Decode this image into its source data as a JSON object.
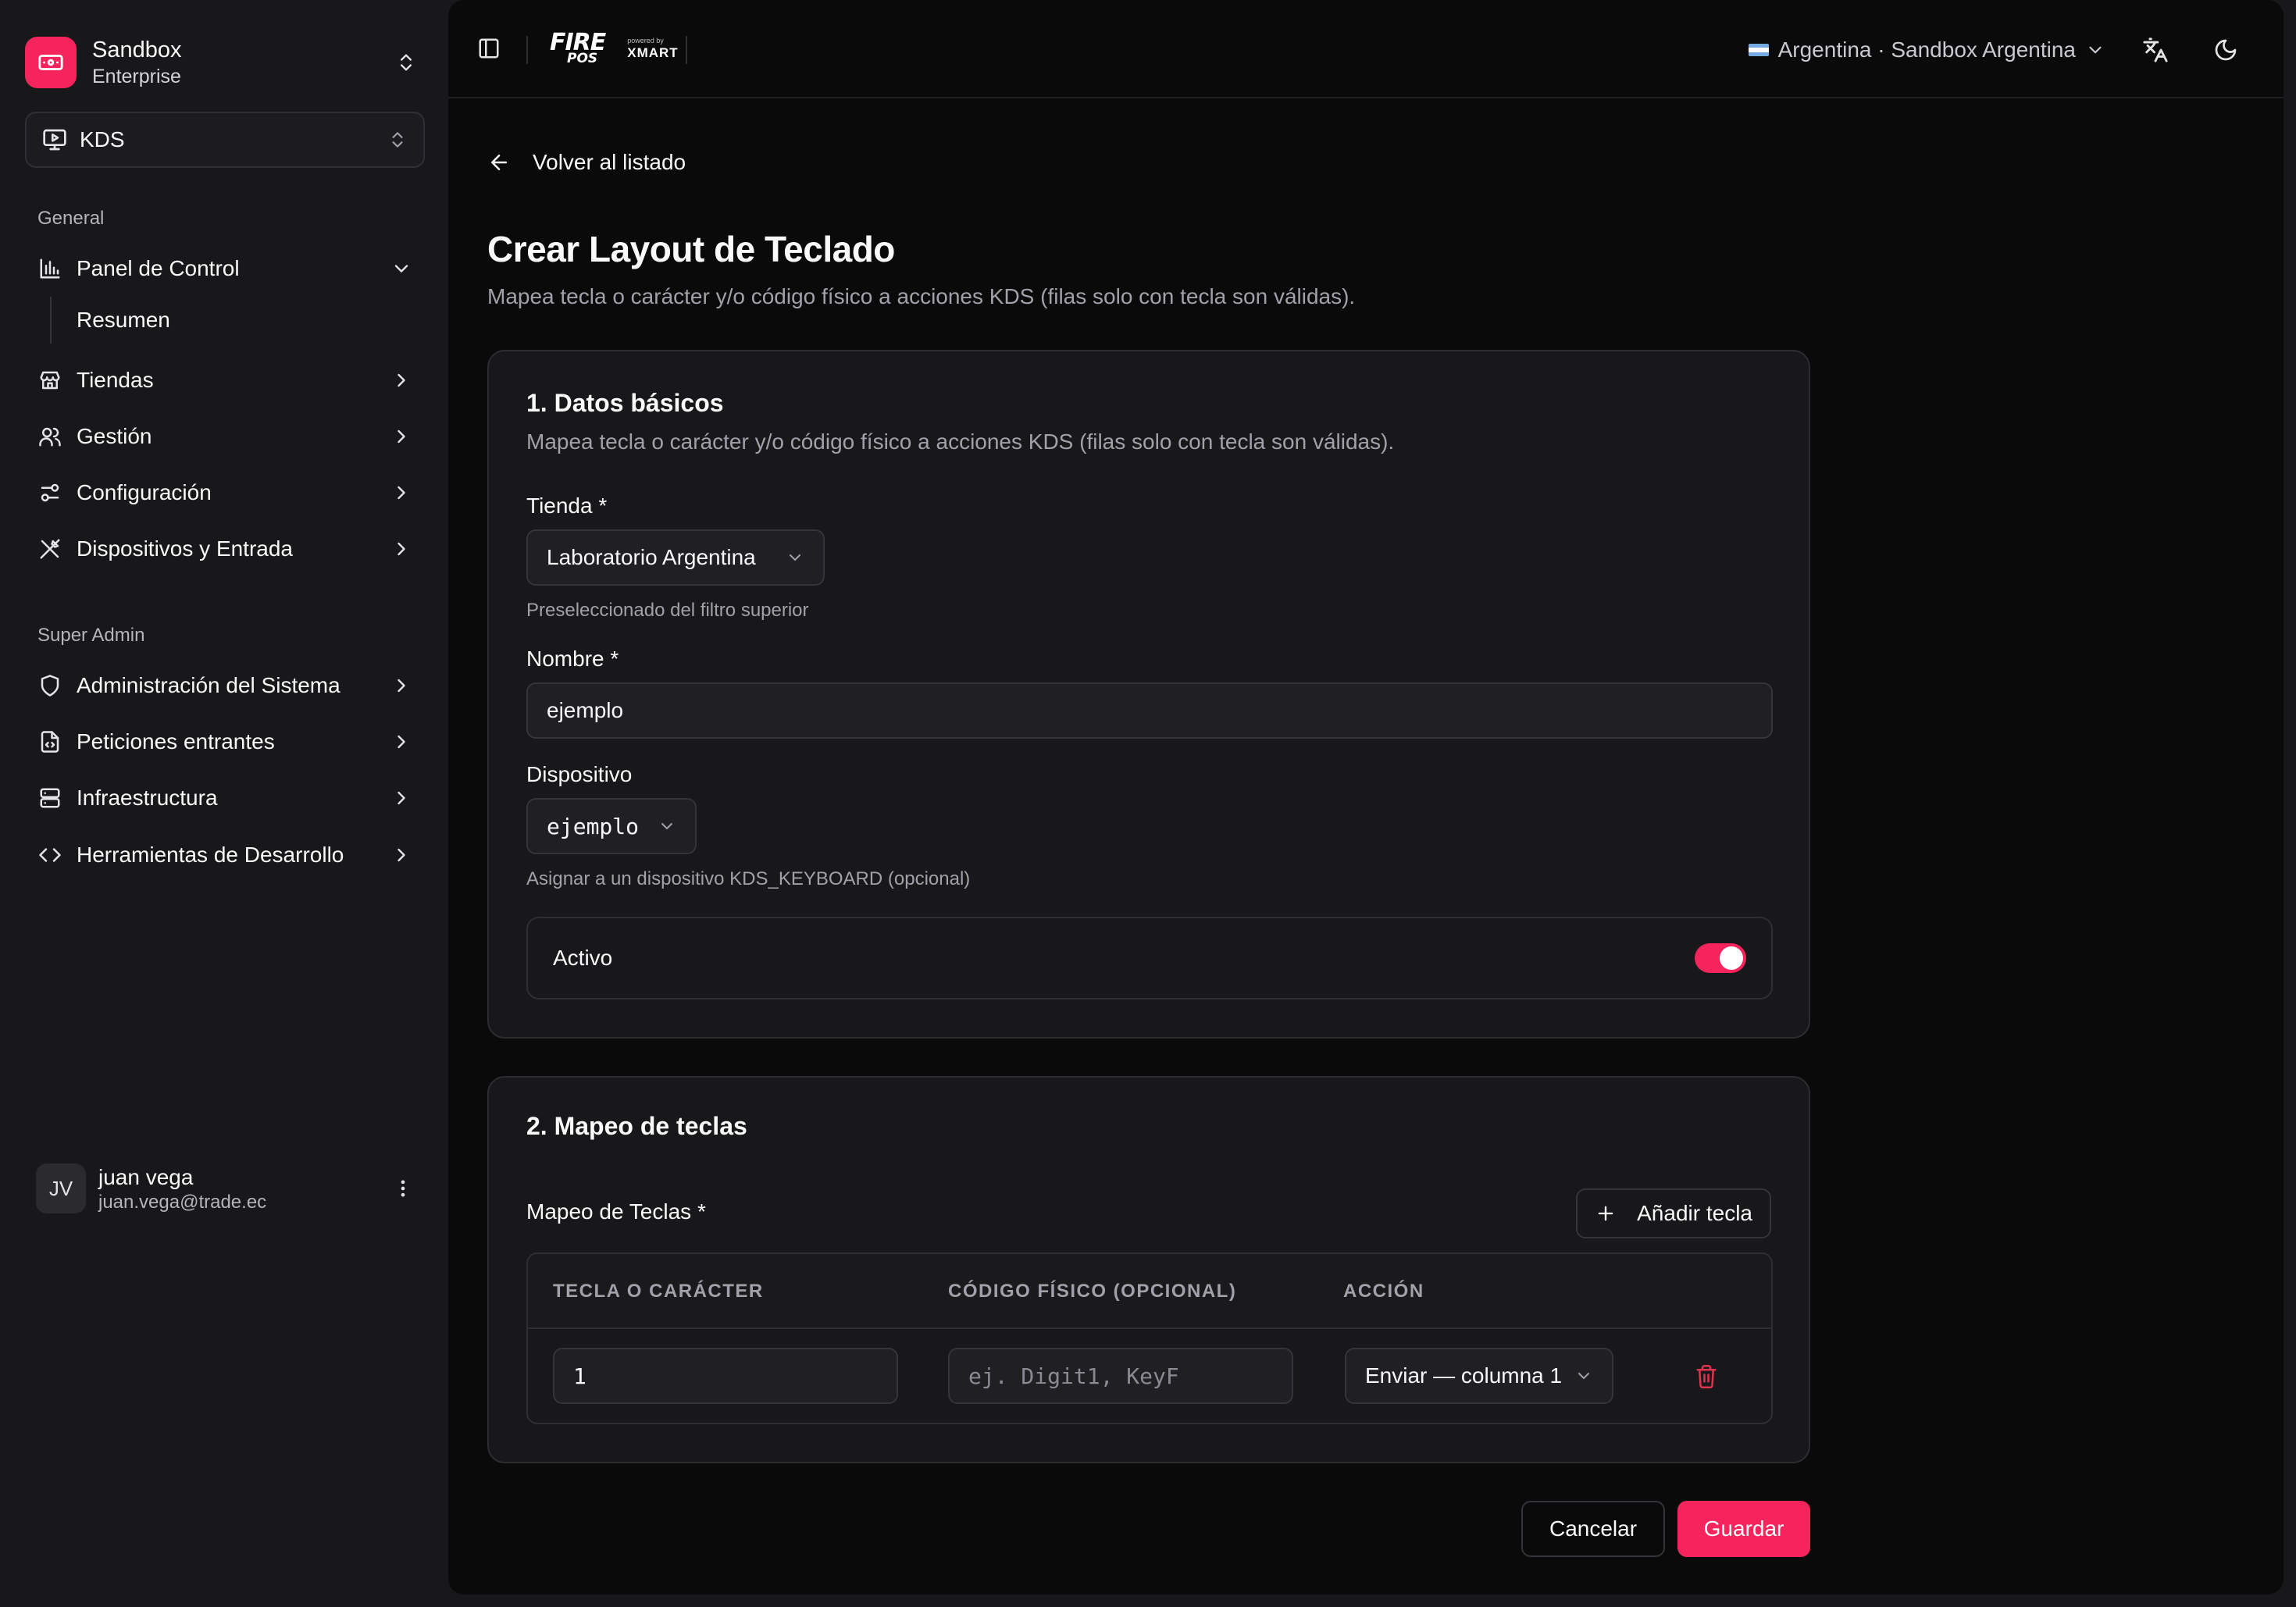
{
  "organization": {
    "name": "Sandbox",
    "plan": "Enterprise"
  },
  "app_selector": {
    "label": "KDS"
  },
  "sidebar": {
    "general_label": "General",
    "general_items": [
      {
        "label": "Panel de Control",
        "icon": "bar-chart-icon",
        "expanded": true
      },
      {
        "label": "Tiendas",
        "icon": "store-icon"
      },
      {
        "label": "Gestión",
        "icon": "users-icon"
      },
      {
        "label": "Configuración",
        "icon": "sliders-icon"
      },
      {
        "label": "Dispositivos y Entrada",
        "icon": "tools-icon"
      }
    ],
    "subitem": "Resumen",
    "super_admin_label": "Super Admin",
    "admin_items": [
      {
        "label": "Administración del Sistema",
        "icon": "shield-icon"
      },
      {
        "label": "Peticiones entrantes",
        "icon": "file-code-icon"
      },
      {
        "label": "Infraestructura",
        "icon": "server-icon"
      },
      {
        "label": "Herramientas de Desarrollo",
        "icon": "code-icon"
      }
    ]
  },
  "user": {
    "initials": "JV",
    "name": "juan vega",
    "email": "juan.vega@trade.ec"
  },
  "topbar": {
    "brand_fire": "FIRE",
    "brand_pos": "POS",
    "brand_powered": "powered by",
    "brand_xmart": "XMART",
    "country": "Argentina · Sandbox Argentina",
    "translate_icon": "translate-icon",
    "theme_icon": "moon-icon"
  },
  "page": {
    "back_label": "Volver al listado",
    "title": "Crear Layout de Teclado",
    "subtitle": "Mapea tecla o carácter y/o código físico a acciones KDS (filas solo con tecla son válidas)."
  },
  "basic": {
    "title": "1. Datos básicos",
    "subtitle": "Mapea tecla o carácter y/o código físico a acciones KDS (filas solo con tecla son válidas).",
    "store_label": "Tienda *",
    "store_value": "Laboratorio Argentina",
    "store_hint": "Preseleccionado del filtro superior",
    "name_label": "Nombre *",
    "name_value": "ejemplo",
    "device_label": "Dispositivo",
    "device_value": "ejemplo",
    "device_hint": "Asignar a un dispositivo KDS_KEYBOARD (opcional)",
    "active_label": "Activo",
    "active": true
  },
  "mapping": {
    "title": "2. Mapeo de teclas",
    "label": "Mapeo de Teclas *",
    "add_label": "Añadir tecla",
    "columns": [
      "TECLA O CARÁCTER",
      "CÓDIGO FÍSICO (OPCIONAL)",
      "ACCIÓN"
    ],
    "rows": [
      {
        "key": "1",
        "code_placeholder": "ej. Digit1, KeyF",
        "action": "Enviar — columna 1"
      }
    ]
  },
  "actions": {
    "cancel": "Cancelar",
    "save": "Guardar"
  },
  "colors": {
    "accent": "#f5245c",
    "background": "#0a0a0b",
    "sidebar": "#18181b"
  }
}
